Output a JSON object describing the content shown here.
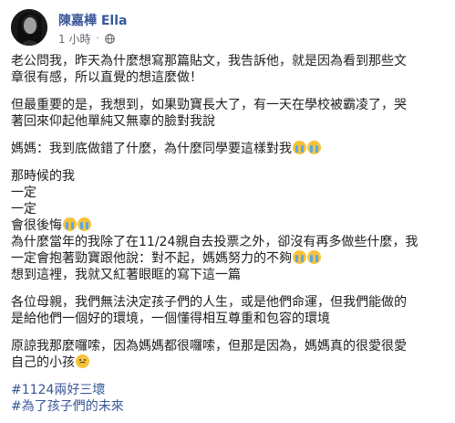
{
  "header": {
    "author": "陳嘉樺 Ella",
    "time": "1 小時",
    "separator": "·",
    "audience_icon": "globe-icon"
  },
  "post": {
    "paragraphs": [
      [
        "老公問我，昨天為什麼想寫那篇貼文，我告訴他，就是因為看到那些文",
        "章很有感，所以直覺的想這麼做！"
      ],
      [
        "但最重要的是，我想到，如果勁寶長大了，有一天在學校被霸凌了，哭",
        "著回來仰起他單純又無辜的臉對我說"
      ],
      [
        "媽媽：我到底做錯了什麼，為什麼同學要這樣對我"
      ],
      [
        "那時候的我",
        "一定",
        "一定",
        "會很後悔",
        "為什麼當年的我除了在11/24親自去投票之外，卻沒有再多做些什麼，我",
        "一定會抱著勁寶跟他說：對不起，媽媽努力的不夠",
        "想到這裡，我就又紅著眼眶的寫下這一篇"
      ],
      [
        "各位母親，我們無法決定孩子們的人生，或是他們命運，但我們能做的",
        "是給他們一個好的環境，一個懂得相互尊重和包容的環境"
      ],
      [
        "原諒我那麼囉嗦，因為媽媽都很囉嗦，但那是因為，媽媽真的很愛很愛",
        "自己的小孩"
      ]
    ],
    "hashtags": [
      "#1124兩好三壞",
      "#為了孩子們的未來"
    ]
  },
  "emoji": {
    "crying": "crying-face-emoji",
    "sad": "sad-face-emoji"
  }
}
